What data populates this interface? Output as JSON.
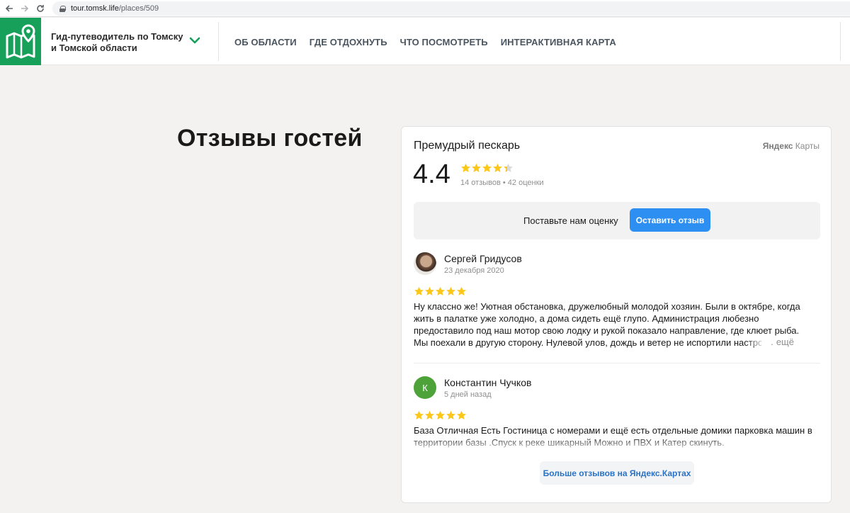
{
  "browser": {
    "url_host": "tour.tomsk.life",
    "url_path": "/places/509"
  },
  "header": {
    "brand": "Гид-путеводитель по Томску и Томской области",
    "nav": [
      {
        "label": "ОБ ОБЛАСТИ"
      },
      {
        "label": "ГДЕ ОТДОХНУТЬ"
      },
      {
        "label": "ЧТО ПОСМОТРЕТЬ"
      },
      {
        "label": "ИНТЕРАКТИВНАЯ КАРТА"
      }
    ]
  },
  "page": {
    "heading": "Отзывы гостей"
  },
  "widget": {
    "place_name": "Премудрый пескарь",
    "provider_bold": "Яндекс",
    "provider_rest": " Карты",
    "rating": "4.4",
    "rating_value": 4.4,
    "rating_meta": "14 отзывов • 42 оценки",
    "cta_text": "Поставьте нам оценку",
    "cta_button": "Оставить отзыв",
    "reviews": [
      {
        "author": "Сергей Гридусов",
        "date": "23 декабря 2020",
        "stars": 5,
        "text": "Ну классно же! Уютная обстановка, дружелюбный молодой хозяин. Были в октябре, когда жить в палатке уже холодно, а дома сидеть ещё глупо. Администрация любезно предоставило под наш мотор свою лодку и рукой показало направление, где клюет рыба. Мы поехали в другую сторону. Нулевой улов, дождь и ветер не испортили настроение.",
        "more": "… ещё"
      },
      {
        "author": "Константин Чучков",
        "initial": "К",
        "date": "5 дней назад",
        "stars": 5,
        "text": "База Отличная Есть Гостиница с номерами и ещё есть отдельные домики парковка машин в территории базы .Спуск к реке шикарный Можно и ПВХ и Катер скинуть."
      }
    ],
    "more_reviews": "Больше отзывов на Яндекс.Картах",
    "colors": {
      "star": "#fcc71b",
      "accent_green": "#16a05a",
      "button_blue": "#2e8ff2"
    }
  }
}
